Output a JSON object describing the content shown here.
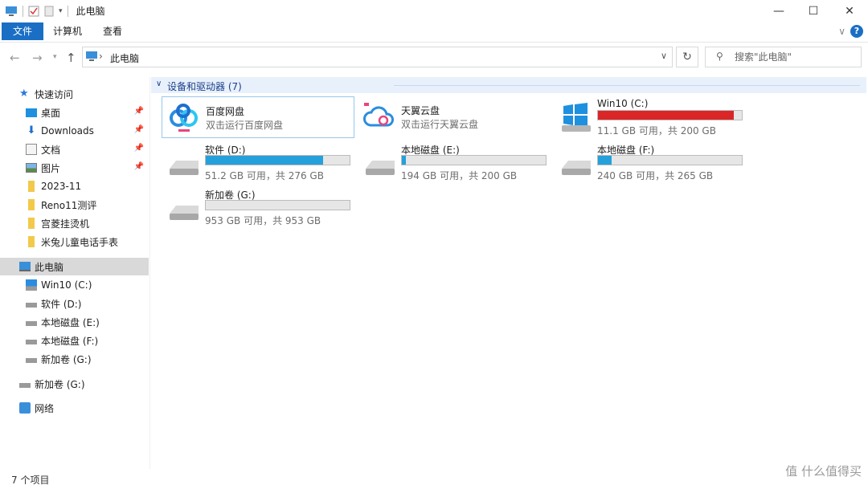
{
  "window": {
    "title": "此电脑"
  },
  "ribbon": {
    "tabs": [
      {
        "label": "文件"
      },
      {
        "label": "计算机"
      },
      {
        "label": "查看"
      }
    ]
  },
  "address": {
    "path": "此电脑"
  },
  "search": {
    "placeholder": "搜索\"此电脑\""
  },
  "sidebar": {
    "quick_access": "快速访问",
    "quick_items": [
      {
        "label": "桌面"
      },
      {
        "label": "Downloads"
      },
      {
        "label": "文档"
      },
      {
        "label": "图片"
      },
      {
        "label": "2023-11"
      },
      {
        "label": "Reno11测评"
      },
      {
        "label": "宫菱挂烫机"
      },
      {
        "label": "米兔儿童电话手表"
      }
    ],
    "this_pc": "此电脑",
    "pc_items": [
      {
        "label": "Win10 (C:)"
      },
      {
        "label": "软件 (D:)"
      },
      {
        "label": "本地磁盘 (E:)"
      },
      {
        "label": "本地磁盘 (F:)"
      },
      {
        "label": "新加卷 (G:)"
      }
    ],
    "extra": {
      "label": "新加卷 (G:)"
    },
    "network": "网络"
  },
  "content": {
    "group_title": "设备和驱动器 (7)",
    "items": [
      {
        "name": "百度网盘",
        "sub": "双击运行百度网盘"
      },
      {
        "name": "天翼云盘",
        "sub": "双击运行天翼云盘"
      },
      {
        "name": "Win10 (C:)",
        "sub": "11.1 GB 可用，共 200 GB",
        "used_fraction": 0.944
      },
      {
        "name": "软件 (D:)",
        "sub": "51.2 GB 可用，共 276 GB",
        "used_fraction": 0.814
      },
      {
        "name": "本地磁盘 (E:)",
        "sub": "194 GB 可用，共 200 GB",
        "used_fraction": 0.03
      },
      {
        "name": "本地磁盘 (F:)",
        "sub": "240 GB 可用，共 265 GB",
        "used_fraction": 0.094
      },
      {
        "name": "新加卷 (G:)",
        "sub": "953 GB 可用，共 953 GB",
        "used_fraction": 0.0
      }
    ]
  },
  "status": {
    "text": "7 个项目"
  },
  "watermark": {
    "text": "值 什么值得买"
  },
  "colors": {
    "accent": "#1a6fc4",
    "bar_normal": "#26a0da",
    "bar_full": "#da2626"
  }
}
